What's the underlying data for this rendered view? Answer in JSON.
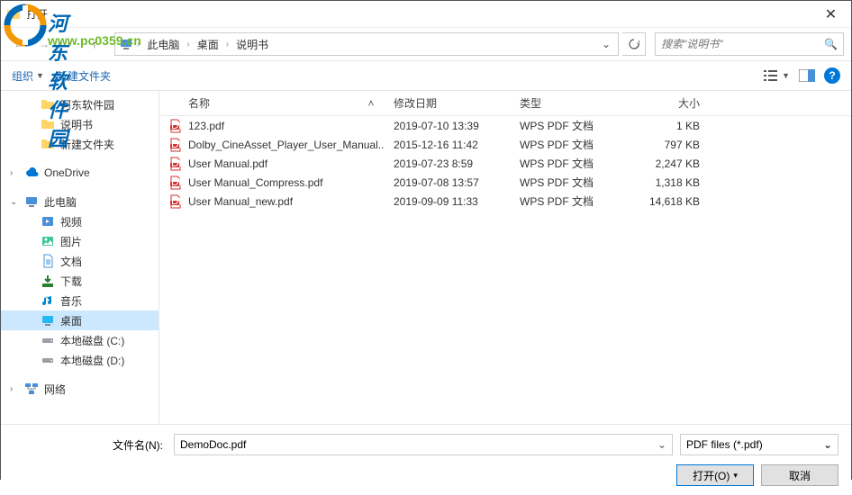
{
  "watermark": {
    "text": "河东软件园",
    "url": "www.pc0359.cn"
  },
  "window": {
    "title": "打开"
  },
  "breadcrumb": {
    "items": [
      "此电脑",
      "桌面",
      "说明书"
    ]
  },
  "search": {
    "placeholder": "搜索\"说明书\""
  },
  "toolbar": {
    "organize": "组织",
    "newfolder": "新建文件夹"
  },
  "columns": {
    "name": "名称",
    "date": "修改日期",
    "type": "类型",
    "size": "大小"
  },
  "sidebar": {
    "folders": [
      "河东软件园",
      "说明书",
      "新建文件夹"
    ],
    "onedrive": "OneDrive",
    "thispc": "此电脑",
    "pcitems": [
      {
        "label": "视频",
        "icon": "video"
      },
      {
        "label": "图片",
        "icon": "image"
      },
      {
        "label": "文档",
        "icon": "doc"
      },
      {
        "label": "下载",
        "icon": "download"
      },
      {
        "label": "音乐",
        "icon": "music"
      },
      {
        "label": "桌面",
        "icon": "desktop",
        "selected": true
      },
      {
        "label": "本地磁盘 (C:)",
        "icon": "drive"
      },
      {
        "label": "本地磁盘 (D:)",
        "icon": "drive"
      }
    ],
    "network": "网络"
  },
  "files": [
    {
      "name": "123.pdf",
      "date": "2019-07-10 13:39",
      "type": "WPS PDF 文档",
      "size": "1 KB"
    },
    {
      "name": "Dolby_CineAsset_Player_User_Manual...",
      "date": "2015-12-16 11:42",
      "type": "WPS PDF 文档",
      "size": "797 KB"
    },
    {
      "name": "User Manual.pdf",
      "date": "2019-07-23 8:59",
      "type": "WPS PDF 文档",
      "size": "2,247 KB"
    },
    {
      "name": "User Manual_Compress.pdf",
      "date": "2019-07-08 13:57",
      "type": "WPS PDF 文档",
      "size": "1,318 KB"
    },
    {
      "name": "User Manual_new.pdf",
      "date": "2019-09-09 11:33",
      "type": "WPS PDF 文档",
      "size": "14,618 KB"
    }
  ],
  "footer": {
    "filename_label": "文件名(N):",
    "filename_value": "DemoDoc.pdf",
    "filter": "PDF files (*.pdf)",
    "open": "打开(O)",
    "cancel": "取消"
  }
}
